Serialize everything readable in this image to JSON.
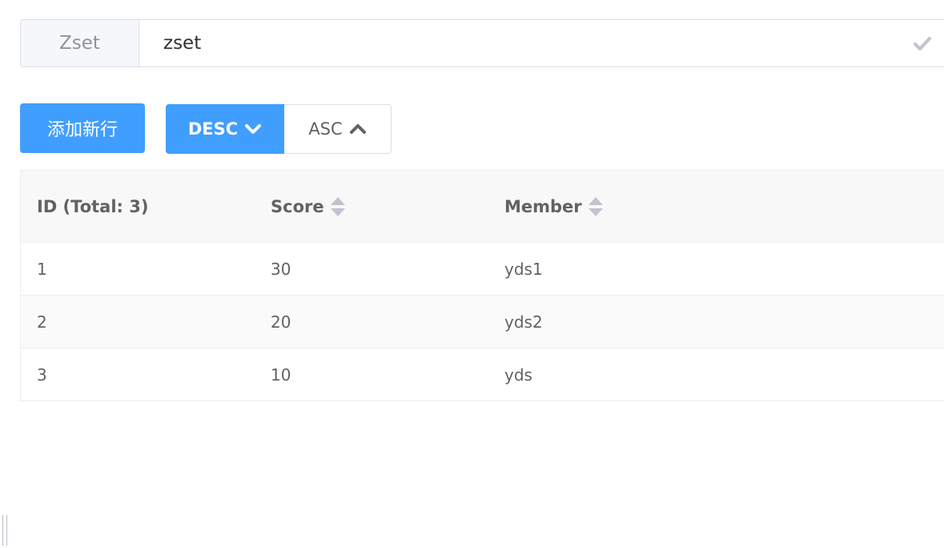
{
  "key": {
    "type_label": "Zset",
    "name_value": "zset",
    "confirm_icon": "check-icon"
  },
  "toolbar": {
    "add_row_label": "添加新行",
    "desc_label": "DESC",
    "asc_label": "ASC",
    "desc_icon": "chevron-down-icon",
    "asc_icon": "chevron-up-icon",
    "active_sort": "DESC"
  },
  "table": {
    "columns": [
      {
        "label": "ID (Total: 3)",
        "sortable": false
      },
      {
        "label": "Score",
        "sortable": true
      },
      {
        "label": "Member",
        "sortable": true
      }
    ],
    "rows": [
      {
        "id": "1",
        "score": "30",
        "member": "yds1"
      },
      {
        "id": "2",
        "score": "20",
        "member": "yds2"
      },
      {
        "id": "3",
        "score": "10",
        "member": "yds"
      }
    ]
  },
  "colors": {
    "primary": "#409eff",
    "header_bg": "#f8f8f9",
    "stripe_bg": "#fafafa",
    "border": "#ebeef5"
  }
}
